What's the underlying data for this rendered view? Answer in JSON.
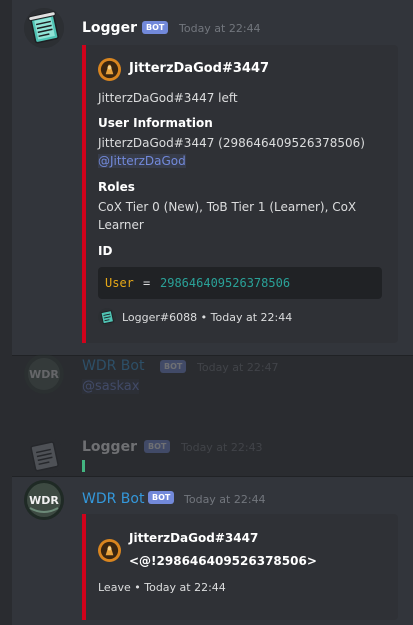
{
  "messages": [
    {
      "author": "Logger",
      "badge": "BOT",
      "timestamp": "Today at 22:44",
      "embed": {
        "author_name": "JitterzDaGod#3447",
        "description": "JitterzDaGod#3447 left",
        "field1_title": "User Information",
        "field1_line": "JitterzDaGod#3447 (298646409526378506)",
        "field1_mention": "@JitterzDaGod",
        "field2_title": "Roles",
        "field2_line1": "CoX Tier 0 (New), ToB Tier 1 (Learner), CoX",
        "field2_line2": "Learner",
        "field3_title": "ID",
        "code_key": "User",
        "code_eq": "=",
        "code_value": "298646409526378506",
        "footer_name": "Logger#6088",
        "footer_sep": "•",
        "footer_time": "Today at 22:44"
      }
    },
    {
      "author": "WDR Bot",
      "badge": "BOT",
      "timestamp": "Today at 22:47",
      "content": "@saskax"
    },
    {
      "author": "Logger",
      "badge": "BOT",
      "timestamp": "Today at 22:43"
    },
    {
      "author": "WDR Bot",
      "badge": "BOT",
      "timestamp": "Today at 22:44",
      "embed": {
        "author_name": "JitterzDaGod#3447",
        "title_line": "<@!298646409526378506>",
        "footer_name": "Leave",
        "footer_sep": "•",
        "footer_time": "Today at 22:44"
      }
    }
  ],
  "colors": {
    "background": "#2a2c30",
    "hover_background": "#32353b",
    "embed_background": "#2f3136",
    "embed_border": "#d0021b",
    "bot_badge": "#7289da",
    "mention": "#7289da",
    "wdr_name": "#3498db",
    "code_key": "#e6a817",
    "code_value": "#2aa198"
  },
  "icons": {
    "logger_avatar": "notebook-icon",
    "wdr_avatar": "wdr-logo-icon",
    "user_avatar": "user-avatar-icon"
  }
}
